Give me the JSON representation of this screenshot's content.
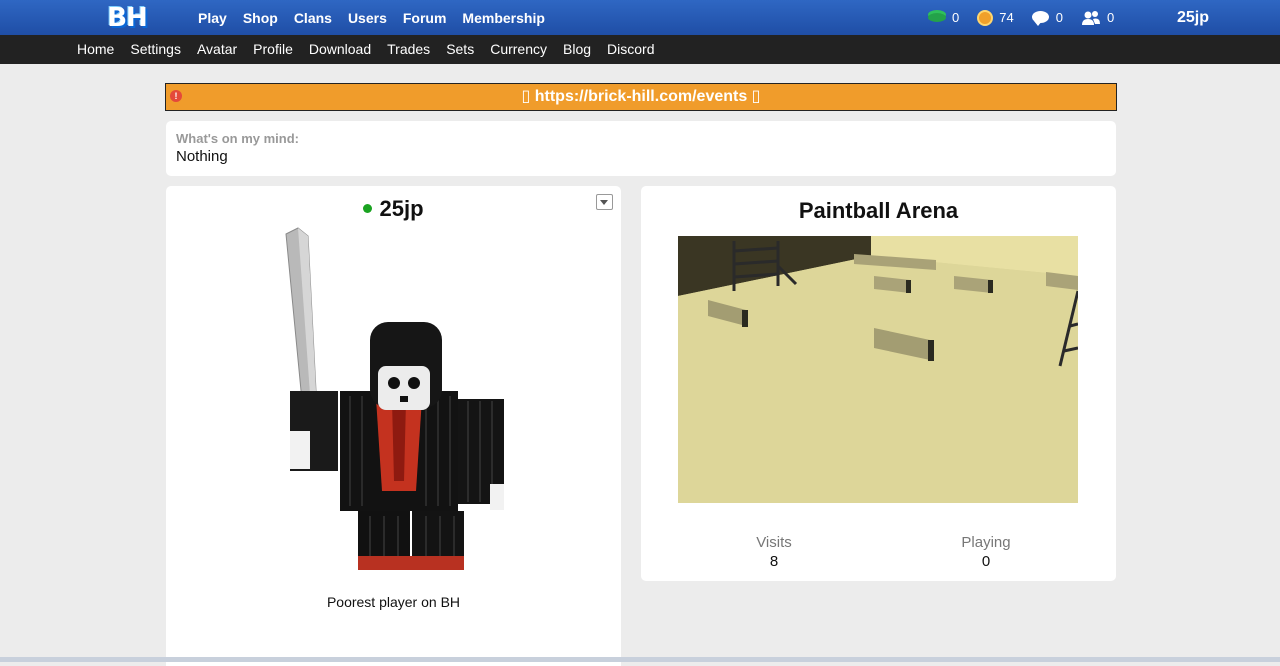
{
  "brand": {
    "logo_text": "BH"
  },
  "main_nav": [
    "Play",
    "Shop",
    "Clans",
    "Users",
    "Forum",
    "Membership"
  ],
  "stats": {
    "bucks": "0",
    "bits": "74",
    "messages": "0",
    "friend_requests": "0"
  },
  "user": {
    "name": "25jp"
  },
  "sub_nav": [
    "Home",
    "Settings",
    "Avatar",
    "Profile",
    "Download",
    "Trades",
    "Sets",
    "Currency",
    "Blog",
    "Discord"
  ],
  "alert": {
    "text": "▯ https://brick-hill.com/events ▯",
    "icon": "alert-icon",
    "color": "#f09c2b"
  },
  "status": {
    "label": "What's on my mind:",
    "value": "Nothing"
  },
  "profile": {
    "username": "25jp",
    "online": true,
    "blurb": "Poorest player on BH"
  },
  "game": {
    "title": "Paintball Arena",
    "visits_label": "Visits",
    "visits": "8",
    "playing_label": "Playing",
    "playing": "0"
  },
  "colors": {
    "topbar": "#2a5fba",
    "subbar": "#222222",
    "online": "#1aa321",
    "alert": "#f09c2b"
  }
}
